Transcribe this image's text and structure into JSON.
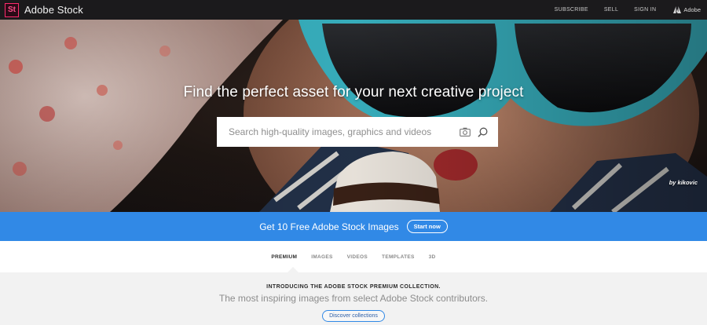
{
  "header": {
    "logo_text": "St",
    "brand": "Adobe Stock",
    "nav": [
      "SUBSCRIBE",
      "SELL",
      "SIGN IN"
    ],
    "adobe_label": "Adobe"
  },
  "hero": {
    "title": "Find the perfect asset for your next creative project",
    "search_placeholder": "Search high-quality images, graphics and videos",
    "credit": "by kikovic"
  },
  "promo": {
    "text": "Get 10 Free Adobe Stock Images",
    "button": "Start now"
  },
  "tabs": [
    "PREMIUM",
    "IMAGES",
    "VIDEOS",
    "TEMPLATES",
    "3D"
  ],
  "premium": {
    "kicker": "INTRODUCING THE ADOBE STOCK PREMIUM COLLECTION.",
    "subtitle": "The most inspiring images from select Adobe Stock contributors.",
    "button": "Discover collections"
  },
  "colors": {
    "accent": "#3189e6",
    "topbar": "#1b1a1c",
    "stock_logo": "#ff2a6d"
  }
}
